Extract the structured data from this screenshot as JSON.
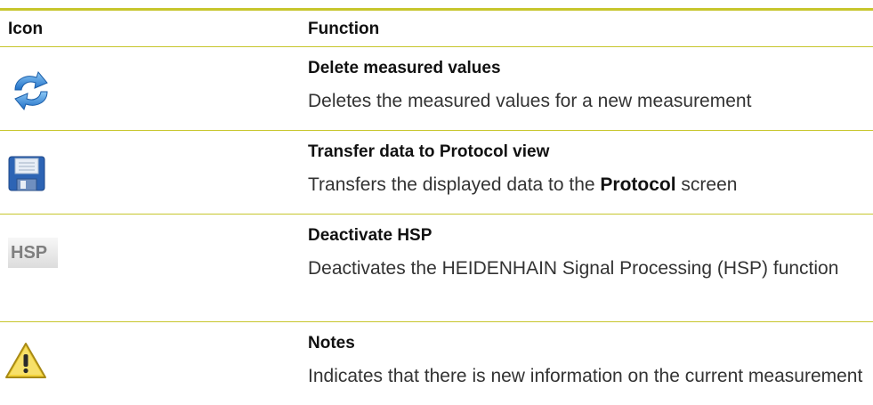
{
  "header": {
    "col_icon": "Icon",
    "col_function": "Function"
  },
  "rows": [
    {
      "icon": "refresh-icon",
      "title": "Delete measured values",
      "desc": "Deletes the measured values for a new measurement"
    },
    {
      "icon": "floppy-disk-icon",
      "title": "Transfer data to Protocol view",
      "desc_before": "Transfers the displayed data to the ",
      "desc_bold": "Protocol",
      "desc_after": " screen"
    },
    {
      "icon": "hsp-icon",
      "icon_text": "HSP",
      "title": "Deactivate HSP",
      "desc": "Deactivates the HEIDENHAIN Signal Processing (HSP) function"
    },
    {
      "icon": "warning-icon",
      "title": "Notes",
      "desc": "Indicates that there is new information on the current measurement"
    }
  ],
  "colors": {
    "rule": "#c7c62d",
    "refresh_blue": "#2a7fd4",
    "disk_blue": "#2d64b4",
    "warning_yellow": "#f2d23a"
  }
}
